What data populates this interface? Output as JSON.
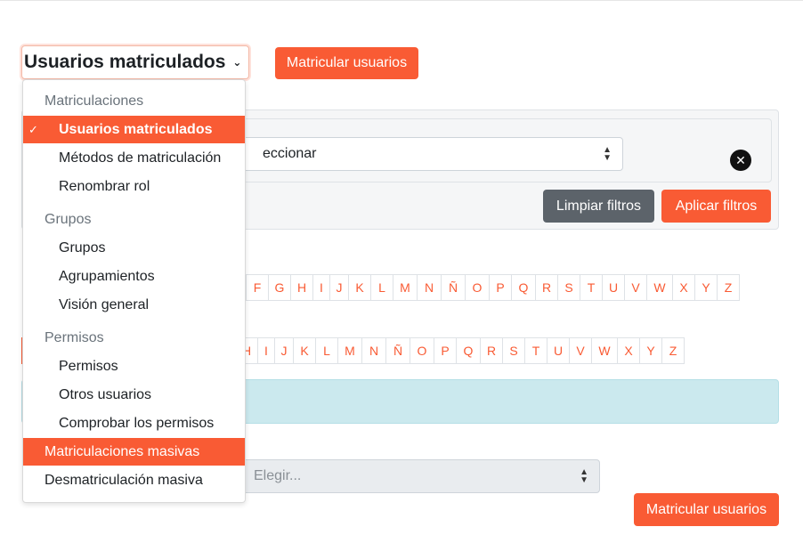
{
  "page": {
    "selector_value": "Usuarios matriculados",
    "enrol_button_top": "Matricular usuarios",
    "enrol_button_bottom": "Matricular usuarios"
  },
  "filters": {
    "select_value_clipped": "eccionar",
    "clear_filters": "Limpiar filtros",
    "apply_filters": "Aplicar filtros"
  },
  "initials_first": [
    "F",
    "G",
    "H",
    "I",
    "J",
    "K",
    "L",
    "M",
    "N",
    "Ñ",
    "O",
    "P",
    "Q",
    "R",
    "S",
    "T",
    "U",
    "V",
    "W",
    "X",
    "Y",
    "Z"
  ],
  "initials_last": [
    "H",
    "I",
    "J",
    "K",
    "L",
    "M",
    "N",
    "Ñ",
    "O",
    "P",
    "Q",
    "R",
    "S",
    "T",
    "U",
    "V",
    "W",
    "X",
    "Y",
    "Z"
  ],
  "bulk": {
    "select_placeholder": "Elegir..."
  },
  "menu": {
    "groups": [
      {
        "header": "Matriculaciones",
        "items": [
          "Usuarios matriculados",
          "Métodos de matriculación",
          "Renombrar rol"
        ]
      },
      {
        "header": "Grupos",
        "items": [
          "Grupos",
          "Agrupamientos",
          "Visión general"
        ]
      },
      {
        "header": "Permisos",
        "items": [
          "Permisos",
          "Otros usuarios",
          "Comprobar los permisos"
        ]
      }
    ],
    "tail_items": [
      "Matriculaciones masivas",
      "Desmatriculación masiva"
    ]
  },
  "colors": {
    "accent": "#f95b34",
    "secondary": "#5c636a",
    "info": "#cbe9ee"
  }
}
